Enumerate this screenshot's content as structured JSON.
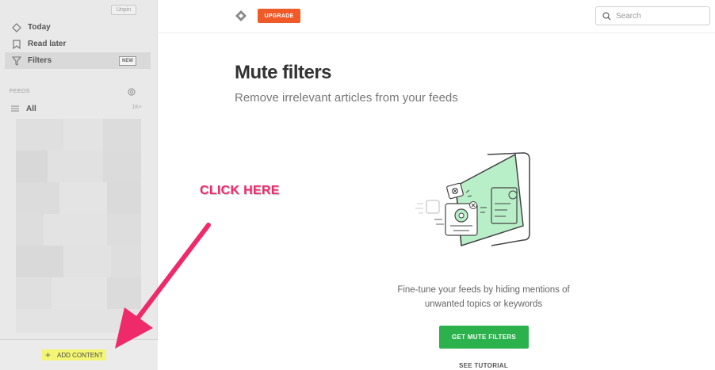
{
  "sidebar": {
    "unpin_label": "Unpin",
    "items": [
      {
        "label": "Today",
        "icon": "today-icon"
      },
      {
        "label": "Read later",
        "icon": "bookmark-icon"
      },
      {
        "label": "Filters",
        "icon": "filter-icon",
        "badge": "NEW",
        "active": true
      }
    ],
    "feeds_label": "FEEDS",
    "all_label": "All",
    "all_count": "1K+",
    "add_content_label": "ADD CONTENT"
  },
  "header": {
    "upgrade_label": "UPGRADE",
    "search_placeholder": "Search"
  },
  "main": {
    "title": "Mute filters",
    "subtitle": "Remove irrelevant articles from your feeds",
    "description": "Fine-tune your feeds by hiding mentions of unwanted topics or keywords",
    "cta_label": "GET MUTE FILTERS",
    "tutorial_label": "SEE TUTORIAL"
  },
  "annotation": {
    "text": "CLICK HERE"
  },
  "colors": {
    "upgrade": "#f05a28",
    "cta": "#2bb24c",
    "annotation": "#ef2a6b",
    "highlight": "#f3f574",
    "illustration_accent": "#b9efc8"
  }
}
